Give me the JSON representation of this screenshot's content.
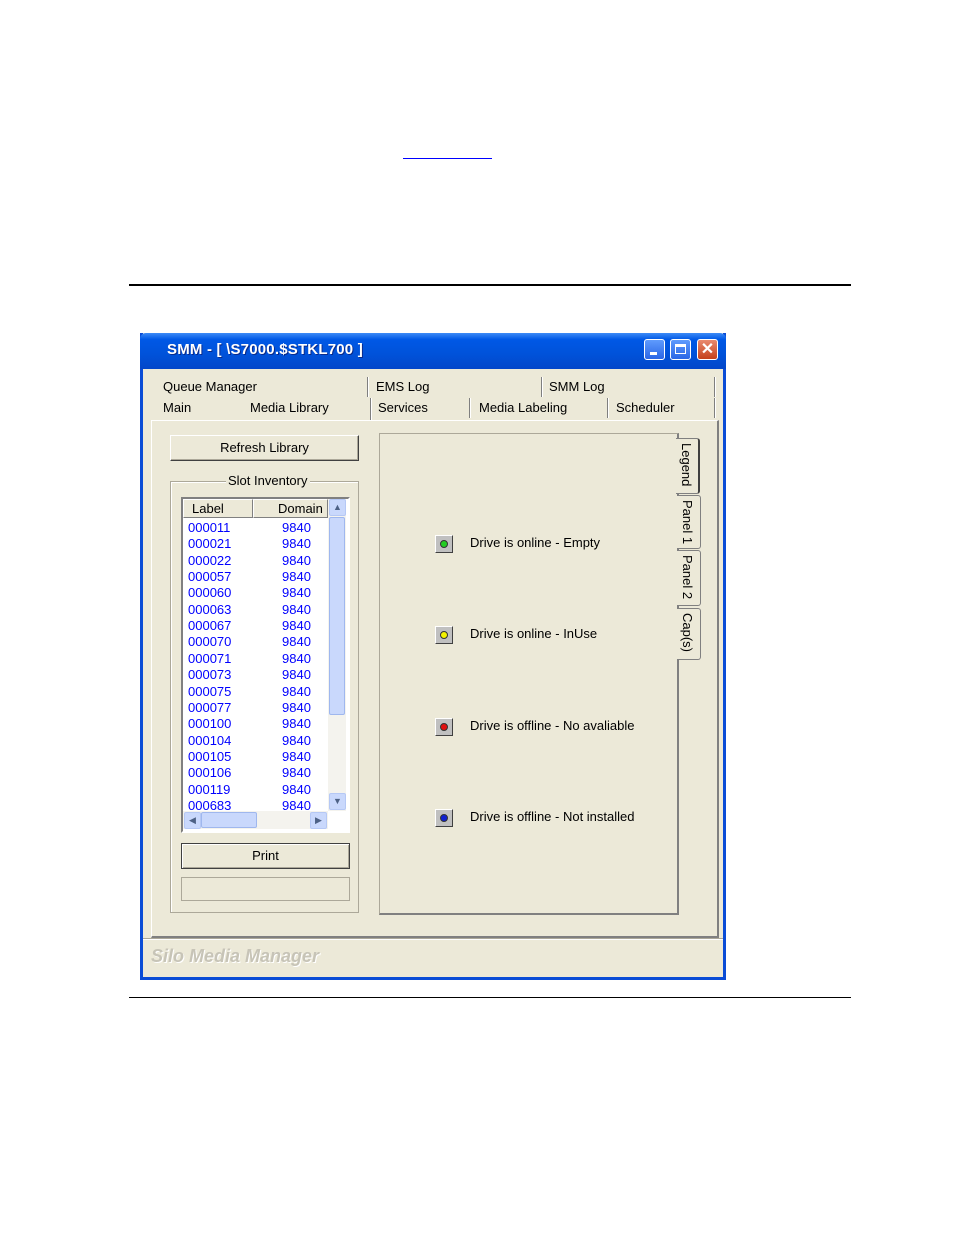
{
  "window": {
    "title": "SMM - [ \\S7000.$STKL700 ]",
    "app_name": "Silo Media Manager"
  },
  "tabs": {
    "row1": [
      "Queue Manager",
      "EMS Log",
      "SMM Log"
    ],
    "row2": [
      "Main",
      "Media Library",
      "Services",
      "Media Labeling",
      "Scheduler"
    ],
    "active": "Media Library"
  },
  "media_library": {
    "refresh_label": "Refresh Library",
    "group_title": "Slot Inventory",
    "columns": [
      "Label",
      "Domain"
    ],
    "rows": [
      {
        "label": "000011",
        "domain": "9840"
      },
      {
        "label": "000021",
        "domain": "9840"
      },
      {
        "label": "000022",
        "domain": "9840"
      },
      {
        "label": "000057",
        "domain": "9840"
      },
      {
        "label": "000060",
        "domain": "9840"
      },
      {
        "label": "000063",
        "domain": "9840"
      },
      {
        "label": "000067",
        "domain": "9840"
      },
      {
        "label": "000070",
        "domain": "9840"
      },
      {
        "label": "000071",
        "domain": "9840"
      },
      {
        "label": "000073",
        "domain": "9840"
      },
      {
        "label": "000075",
        "domain": "9840"
      },
      {
        "label": "000077",
        "domain": "9840"
      },
      {
        "label": "000100",
        "domain": "9840"
      },
      {
        "label": "000104",
        "domain": "9840"
      },
      {
        "label": "000105",
        "domain": "9840"
      },
      {
        "label": "000106",
        "domain": "9840"
      },
      {
        "label": "000119",
        "domain": "9840"
      },
      {
        "label": "000683",
        "domain": "9840"
      }
    ],
    "print_label": "Print"
  },
  "side_tabs": [
    "Legend",
    "Panel 1",
    "Panel 2",
    "Cap(s)"
  ],
  "legend": [
    {
      "text": "Drive is online - Empty",
      "color": "#22cc22"
    },
    {
      "text": "Drive is online - InUse",
      "color": "#f2f200"
    },
    {
      "text": "Drive is offline - No avaliable",
      "color": "#e01010"
    },
    {
      "text": "Drive is offline - Not installed",
      "color": "#1020d0"
    }
  ]
}
